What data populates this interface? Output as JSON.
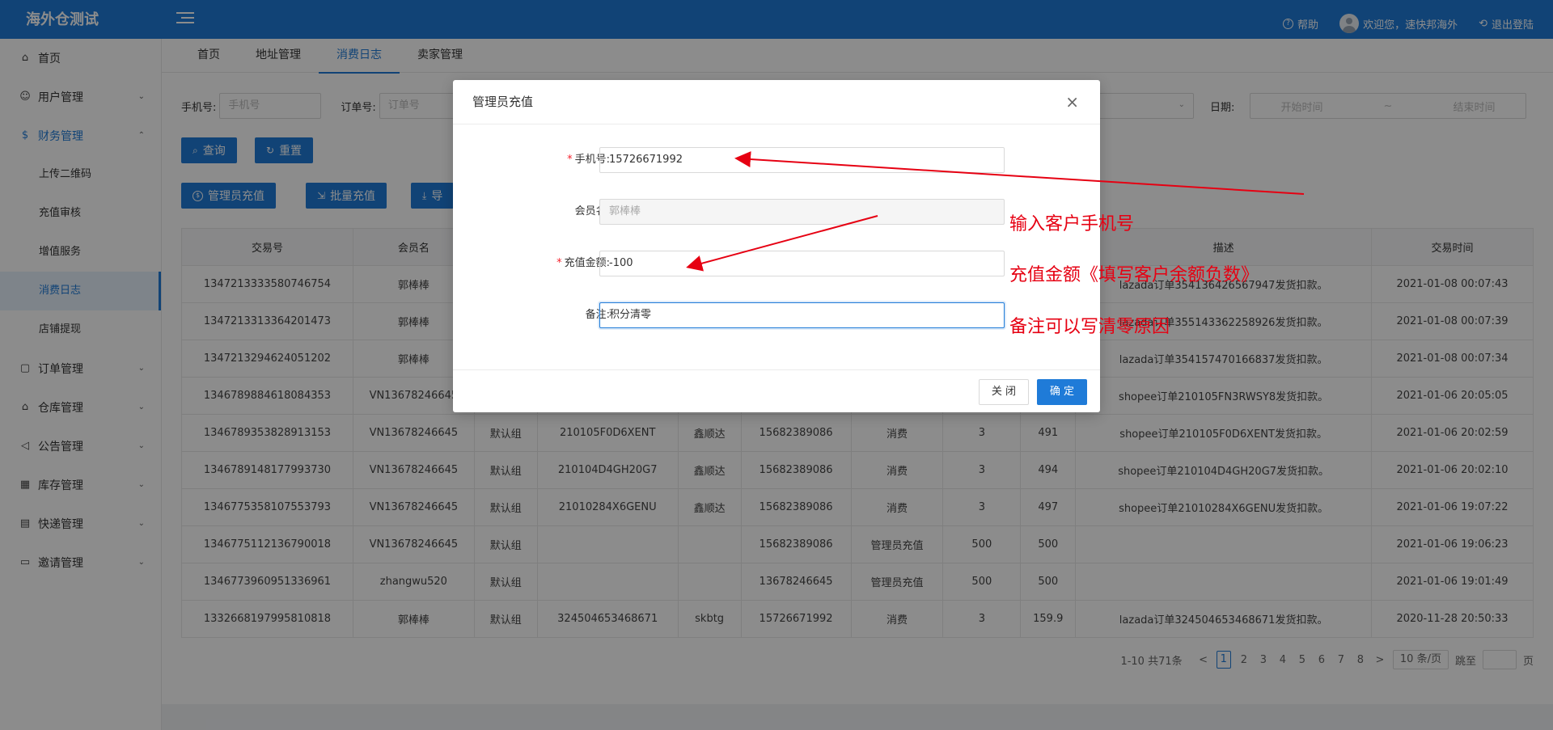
{
  "app": {
    "title": "海外仓测试"
  },
  "header": {
    "help": "帮助",
    "welcome": "欢迎您，速快邦海外",
    "logout": "退出登陆"
  },
  "sidebar": {
    "items": [
      {
        "label": "首页",
        "icon": "home-icon"
      },
      {
        "label": "用户管理",
        "icon": "user-icon"
      },
      {
        "label": "财务管理",
        "icon": "finance-icon"
      },
      {
        "label": "上传二维码"
      },
      {
        "label": "充值审核"
      },
      {
        "label": "增值服务"
      },
      {
        "label": "消费日志"
      },
      {
        "label": "店铺提现"
      },
      {
        "label": "订单管理",
        "icon": "bag-icon"
      },
      {
        "label": "仓库管理",
        "icon": "warehouse-icon"
      },
      {
        "label": "公告管理",
        "icon": "megaphone-icon"
      },
      {
        "label": "库存管理",
        "icon": "grid-icon"
      },
      {
        "label": "快递管理",
        "icon": "document-icon"
      },
      {
        "label": "邀请管理",
        "icon": "card-icon"
      }
    ]
  },
  "tabs": [
    "首页",
    "地址管理",
    "消费日志",
    "卖家管理"
  ],
  "filters": {
    "phone_label": "手机号:",
    "phone_placeholder": "手机号",
    "order_label": "订单号:",
    "order_placeholder": "订单号",
    "date_label": "日期:",
    "date_start": "开始时间",
    "date_sep": "~",
    "date_end": "结束时间"
  },
  "buttons": {
    "query": "查询",
    "reset": "重置",
    "admin_recharge": "管理员充值",
    "batch_recharge": "批量充值",
    "export": "导"
  },
  "table": {
    "headers": [
      "交易号",
      "会员名",
      "",
      "",
      "",
      "",
      "",
      "",
      "",
      "描述",
      "交易时间"
    ],
    "rows": [
      [
        "1347213333580746754",
        "郭棒棒",
        "",
        "",
        "",
        "",
        "",
        "",
        "",
        "lazada订单354136426567947发货扣款。",
        "2021-01-08 00:07:43"
      ],
      [
        "1347213313364201473",
        "郭棒棒",
        "",
        "",
        "",
        "",
        "",
        "",
        "",
        "lazada订单355143362258926发货扣款。",
        "2021-01-08 00:07:39"
      ],
      [
        "1347213294624051202",
        "郭棒棒",
        "",
        "",
        "",
        "",
        "",
        "",
        "",
        "lazada订单354157470166837发货扣款。",
        "2021-01-08 00:07:34"
      ],
      [
        "1346789884618084353",
        "VN13678246645",
        "",
        "",
        "",
        "",
        "",
        "",
        "",
        "shopee订单210105FN3RWSY8发货扣款。",
        "2021-01-06 20:05:05"
      ],
      [
        "1346789353828913153",
        "VN13678246645",
        "默认组",
        "210105F0D6XENT",
        "鑫顺达",
        "15682389086",
        "消费",
        "3",
        "491",
        "shopee订单210105F0D6XENT发货扣款。",
        "2021-01-06 20:02:59"
      ],
      [
        "1346789148177993730",
        "VN13678246645",
        "默认组",
        "210104D4GH20G7",
        "鑫顺达",
        "15682389086",
        "消费",
        "3",
        "494",
        "shopee订单210104D4GH20G7发货扣款。",
        "2021-01-06 20:02:10"
      ],
      [
        "1346775358107553793",
        "VN13678246645",
        "默认组",
        "21010284X6GENU",
        "鑫顺达",
        "15682389086",
        "消费",
        "3",
        "497",
        "shopee订单21010284X6GENU发货扣款。",
        "2021-01-06 19:07:22"
      ],
      [
        "1346775112136790018",
        "VN13678246645",
        "默认组",
        "",
        "",
        "15682389086",
        "管理员充值",
        "500",
        "500",
        "",
        "2021-01-06 19:06:23"
      ],
      [
        "1346773960951336961",
        "zhangwu520",
        "默认组",
        "",
        "",
        "13678246645",
        "管理员充值",
        "500",
        "500",
        "",
        "2021-01-06 19:01:49"
      ],
      [
        "1332668197995810818",
        "郭棒棒",
        "默认组",
        "324504653468671",
        "skbtg",
        "15726671992",
        "消费",
        "3",
        "159.9",
        "lazada订单324504653468671发货扣款。",
        "2020-11-28 20:50:33"
      ]
    ]
  },
  "pager": {
    "summary": "1-10 共71条",
    "prev": "<",
    "pages": [
      "1",
      "2",
      "3",
      "4",
      "5",
      "6",
      "7",
      "8"
    ],
    "next": ">",
    "size": "10 条/页",
    "jump_label": "跳至",
    "page_suffix": "页"
  },
  "modal": {
    "title": "管理员充值",
    "fields": [
      {
        "label": "手机号:",
        "value": "15726671992",
        "required": true
      },
      {
        "label": "会员名:",
        "value": "郭棒棒",
        "required": false
      },
      {
        "label": "充值金额:",
        "value": "-100",
        "required": true
      },
      {
        "label": "备注:",
        "value": "积分清零",
        "required": false
      }
    ],
    "close_label": "关 闭",
    "ok_label": "确 定"
  },
  "annotations": {
    "phone": "输入客户手机号",
    "amount": "充值金额《填写客户余额负数》",
    "remark": "备注可以写清零原因",
    "color": "#e60012"
  }
}
